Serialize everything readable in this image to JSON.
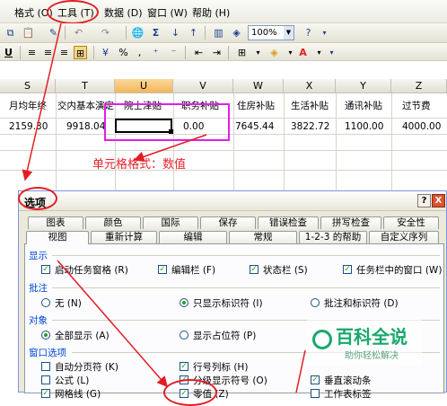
{
  "menubar": {
    "items": [
      {
        "label": "格式 (O)"
      },
      {
        "label": "工具 (T)"
      },
      {
        "label": "数据 (D)"
      },
      {
        "label": "窗口 (W)"
      },
      {
        "label": "帮助 (H)"
      }
    ]
  },
  "toolbar": {
    "zoom": "100%",
    "sum_icon": "Σ",
    "font_color": "A"
  },
  "sheet": {
    "columns": [
      "S",
      "T",
      "U",
      "V",
      "W",
      "X",
      "Y",
      "Z"
    ],
    "headers": [
      "月均年终",
      "交内基本演定",
      "院士津贴",
      "职务补贴",
      "住房补贴",
      "生活补贴",
      "通讯补贴",
      "过节费"
    ],
    "values": [
      "2159.30",
      "9918.04",
      "",
      "0.00",
      "7645.44",
      "3822.72",
      "1100.00",
      "4000.00"
    ]
  },
  "annotation": {
    "label": "单元格格式：数值",
    "color": "#e8212a"
  },
  "dialog": {
    "title": "选项",
    "help": "?",
    "close": "X",
    "tabs_row1": [
      "图表",
      "颜色",
      "国际",
      "保存",
      "错误检查",
      "拼写检查",
      "安全性"
    ],
    "tabs_row2": [
      "视图",
      "重新计算",
      "编辑",
      "常规",
      "1-2-3 的帮助",
      "自定义序列"
    ],
    "groups": {
      "show": "显示",
      "comments": "批注",
      "objects": "对象",
      "window": "窗口选项"
    },
    "show_options": [
      "启动任务窗格 (R)",
      "编辑栏 (F)",
      "状态栏 (S)",
      "任务栏中的窗口 (W)"
    ],
    "comment_options": [
      "无 (N)",
      "只显示标识符 (I)",
      "批注和标识符 (D)"
    ],
    "object_options": [
      "全部显示 (A)",
      "显示占位符 (P)"
    ],
    "window_options": [
      "自动分页符 (K)",
      "公式 (L)",
      "网格线 (G)",
      "行号列标 (H)",
      "分级显示符号 (O)",
      "零值 (Z)",
      "垂直滚动条",
      "工作表标签"
    ]
  },
  "watermark": {
    "title": "百科全说",
    "subtitle": "助你轻松解决"
  }
}
